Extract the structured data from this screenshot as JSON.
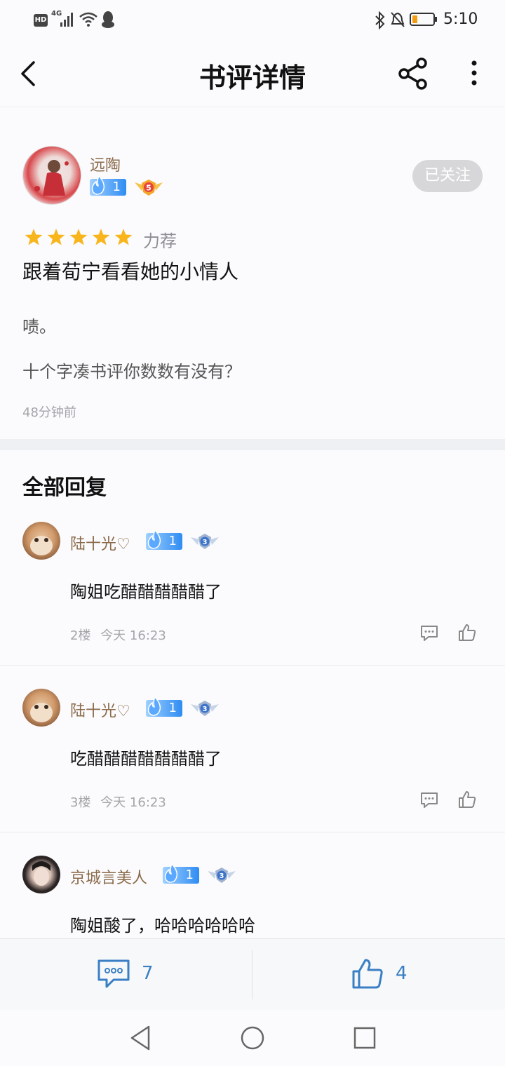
{
  "status_bar": {
    "hd": "HD",
    "network": "4G",
    "time": "5:10",
    "icons": [
      "signal-icon",
      "wifi-icon",
      "qq-icon",
      "bluetooth-icon",
      "mute-icon",
      "battery-icon"
    ]
  },
  "header": {
    "title": "书评详情",
    "icons": [
      "back-arrow-icon",
      "share-icon",
      "more-icon"
    ]
  },
  "review": {
    "author": "远陶",
    "level": "1",
    "rank": "5",
    "follow_label": "已关注",
    "rating": 5,
    "recommend_label": "力荐",
    "title": "跟着荀宁看看她的小情人",
    "paragraphs": [
      "啧。",
      "十个字凑书评你数数有没有？"
    ],
    "time": "48分钟前"
  },
  "replies_section": {
    "heading": "全部回复",
    "replies": [
      {
        "name": "陆十光♡",
        "level": "1",
        "rank": "3",
        "content": "陶姐吃醋醋醋醋醋了",
        "floor": "2楼",
        "time": "今天 16:23"
      },
      {
        "name": "陆十光♡",
        "level": "1",
        "rank": "3",
        "content": "吃醋醋醋醋醋醋醋了",
        "floor": "3楼",
        "time": "今天 16:23"
      },
      {
        "name": "京城言美人",
        "level": "1",
        "rank": "3",
        "content": "陶姐酸了，哈哈哈哈哈哈",
        "floor": "",
        "time": ""
      }
    ]
  },
  "bottom_bar": {
    "comment_count": "7",
    "like_count": "4"
  },
  "colors": {
    "accent": "#3a7fc4",
    "username": "#8a6a4a",
    "star": "#f8b51c",
    "level_badge": "#2f8cf2"
  }
}
